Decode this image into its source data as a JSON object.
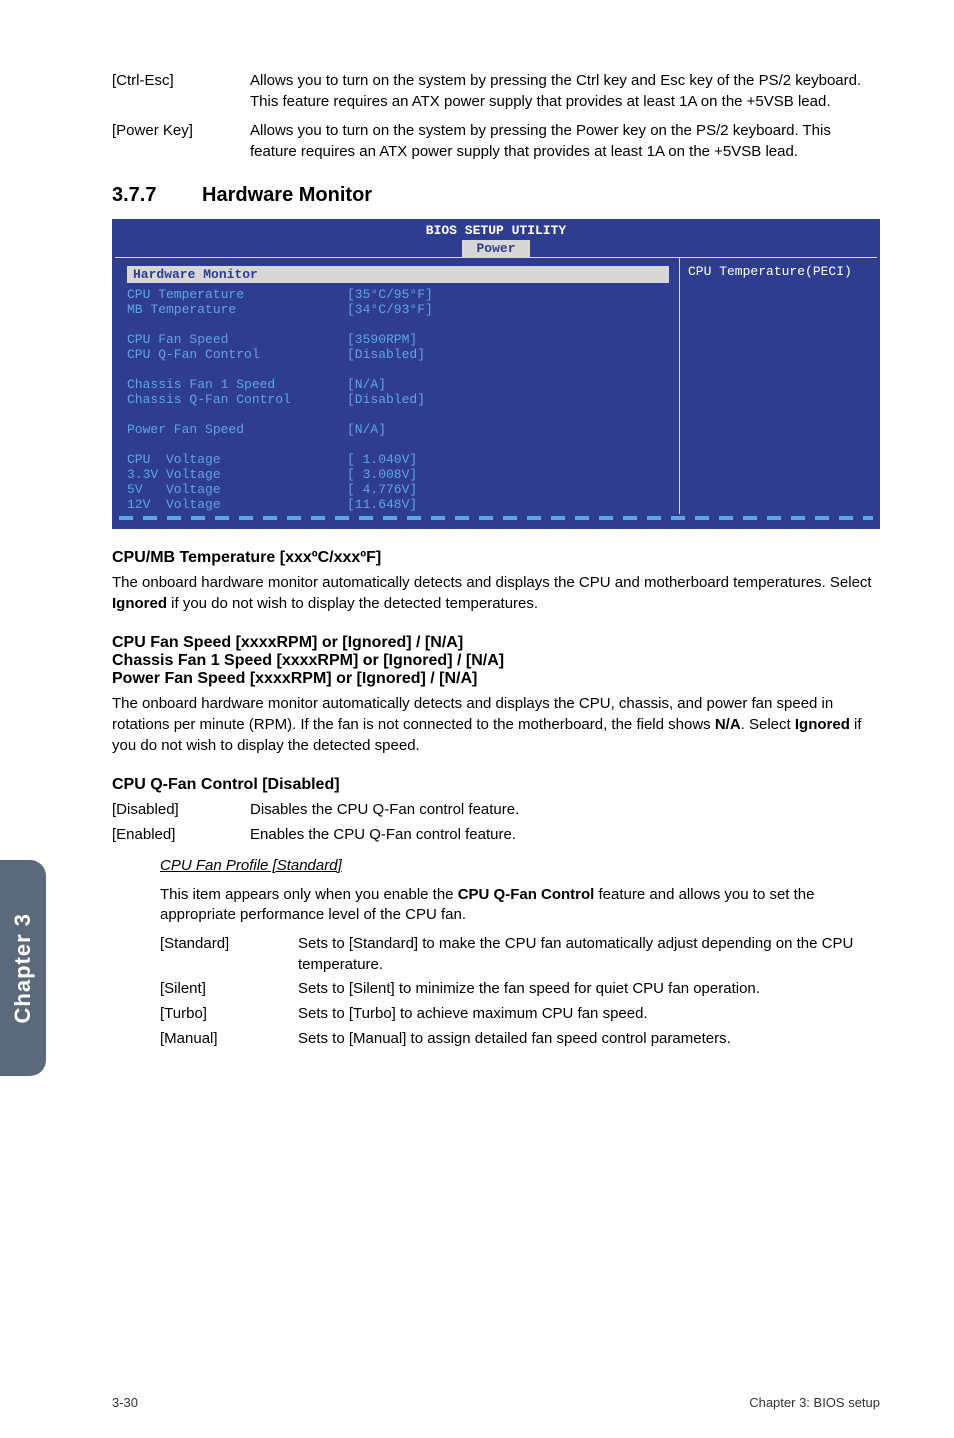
{
  "opts": [
    {
      "key": "[Ctrl-Esc]",
      "txt": "Allows you to turn on the system by pressing the Ctrl key and Esc key of the PS/2 keyboard. This feature requires an ATX power supply that provides at least 1A on the +5VSB lead."
    },
    {
      "key": "[Power Key]",
      "txt": "Allows you to turn on the system by pressing the Power key on the PS/2 keyboard. This feature requires an ATX power supply that provides at least 1A on the +5VSB lead."
    }
  ],
  "section": {
    "num": "3.7.7",
    "title": "Hardware Monitor"
  },
  "bios": {
    "header": "BIOS SETUP UTILITY",
    "tab": "Power",
    "section_title": "Hardware Monitor",
    "right": "CPU Temperature(PECI)",
    "rows": [
      {
        "l": "CPU Temperature",
        "v": "[35°C/95°F]"
      },
      {
        "l": "MB Temperature",
        "v": "[34°C/93°F]"
      },
      {
        "gap": true
      },
      {
        "l": "CPU Fan Speed",
        "v": "[3590RPM]"
      },
      {
        "l": "CPU Q-Fan Control",
        "v": "[Disabled]"
      },
      {
        "gap": true
      },
      {
        "l": "Chassis Fan 1 Speed",
        "v": "[N/A]"
      },
      {
        "l": "Chassis Q-Fan Control",
        "v": "[Disabled]"
      },
      {
        "gap": true
      },
      {
        "l": "Power Fan Speed",
        "v": "[N/A]"
      },
      {
        "gap": true
      },
      {
        "l": "CPU  Voltage",
        "v": "[ 1.040V]"
      },
      {
        "l": "3.3V Voltage",
        "v": "[ 3.008V]"
      },
      {
        "l": "5V   Voltage",
        "v": "[ 4.776V]"
      },
      {
        "l": "12V  Voltage",
        "v": "[11.648V]"
      }
    ]
  },
  "h3a": "CPU/MB Temperature [xxxºC/xxxºF]",
  "pa": "The onboard hardware monitor automatically detects and displays the CPU and motherboard temperatures. Select ",
  "pa_bold": "Ignored",
  "pa_end": " if you do not wish to display the detected temperatures.",
  "h3b1": "CPU Fan Speed [xxxxRPM] or [Ignored] / [N/A]",
  "h3b2": "Chassis Fan 1 Speed [xxxxRPM] or [Ignored] / [N/A]",
  "h3b3": "Power Fan Speed [xxxxRPM] or [Ignored] / [N/A]",
  "pb_pre": "The onboard hardware monitor automatically detects and displays the CPU, chassis, and power fan speed in rotations per minute (RPM). If the fan is not connected to the motherboard, the field shows ",
  "pb_b1": "N/A",
  "pb_mid": ". Select ",
  "pb_b2": "Ignored",
  "pb_end": " if you do not wish to display the detected speed.",
  "h3c": "CPU Q-Fan Control [Disabled]",
  "defs1": [
    {
      "k": "[Disabled]",
      "v": "Disables the CPU Q-Fan control feature."
    },
    {
      "k": "[Enabled]",
      "v": "Enables the CPU Q-Fan control feature."
    }
  ],
  "sub_head": "CPU Fan Profile [Standard]",
  "sub_p_pre": "This item appears only when you enable the ",
  "sub_p_bold": "CPU Q-Fan Control",
  "sub_p_end": " feature and allows you to set the appropriate performance level of the CPU fan.",
  "defs2": [
    {
      "k": "[Standard]",
      "v": "Sets to [Standard] to make the CPU fan automatically adjust depending on the CPU temperature."
    },
    {
      "k": "[Silent]",
      "v": "Sets to [Silent] to minimize the fan speed for quiet CPU fan operation."
    },
    {
      "k": "[Turbo]",
      "v": "Sets to [Turbo] to achieve maximum CPU fan speed."
    },
    {
      "k": "[Manual]",
      "v": "Sets to [Manual] to assign detailed fan speed control parameters."
    }
  ],
  "sidetab": "Chapter 3",
  "footer": {
    "left": "3-30",
    "right": "Chapter 3: BIOS setup"
  }
}
